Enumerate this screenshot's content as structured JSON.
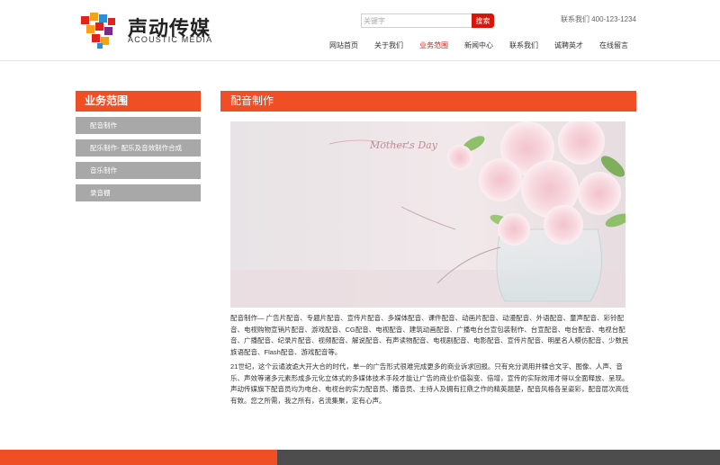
{
  "logo": {
    "cn": "声动传媒",
    "en": "ACOUSTIC MEDIA"
  },
  "search": {
    "placeholder": "关键字",
    "button": "搜索"
  },
  "contact": "联系我们 400-123-1234",
  "nav": [
    {
      "label": "网站首页",
      "active": false
    },
    {
      "label": "关于我们",
      "active": false
    },
    {
      "label": "业务范围",
      "active": true
    },
    {
      "label": "新闻中心",
      "active": false
    },
    {
      "label": "联系我们",
      "active": false
    },
    {
      "label": "诚聘英才",
      "active": false
    },
    {
      "label": "在线留言",
      "active": false
    }
  ],
  "sidebar": {
    "title": "业务范围",
    "items": [
      {
        "label": "配音制作"
      },
      {
        "label": "配乐制作- 配乐及音效制作合成"
      },
      {
        "label": "音乐制作"
      },
      {
        "label": "录音棚"
      }
    ]
  },
  "main": {
    "title": "配音制作",
    "banner_text": "Mother's Day",
    "paragraphs": [
      "配音制作— 广告片配音、专题片配音、宣传片配音、多媒体配音、课件配音、动画片配音、动漫配音、外语配音、童声配音、彩铃配音、电视购物宣销片配音、游戏配音、CG配音、电视配音、建筑动画配音、广播电台台宣包装制作、台宣配音、电台配音、电视台配音、广播配音、纪录片配音、视频配音、解说配音、有声读物配音、电视剧配音、电影配音、宣传片配音、明星名人模仿配音、少数民族语配音、Flash配音、游戏配音等。",
      "21世纪，这个云谲波诡大开大合的时代，单一的广告形式很难完成更多的商业诉求回报。只有充分调用并糅合文字、图像、人声、音乐、声效等诸多元素形成多元化立体式的多媒体技术手段才能让广告的商业价值裂变、倍增，宣传的实际效用才得以全面释放、呈现。声动传媒旗下配音员均为电台、电视台的实力配音员、播音员、主持人及拥有扛鼎之作的精英翘楚，配音风格各呈姿彩，配音层次高低有致。您之所需，我之所有，名流集聚，定有心声。"
    ]
  },
  "colors": {
    "accent": "#f04f26",
    "red": "#d5160a",
    "sidebar_item": "#a8a8a8",
    "footer_dark": "#4d4d4d"
  }
}
